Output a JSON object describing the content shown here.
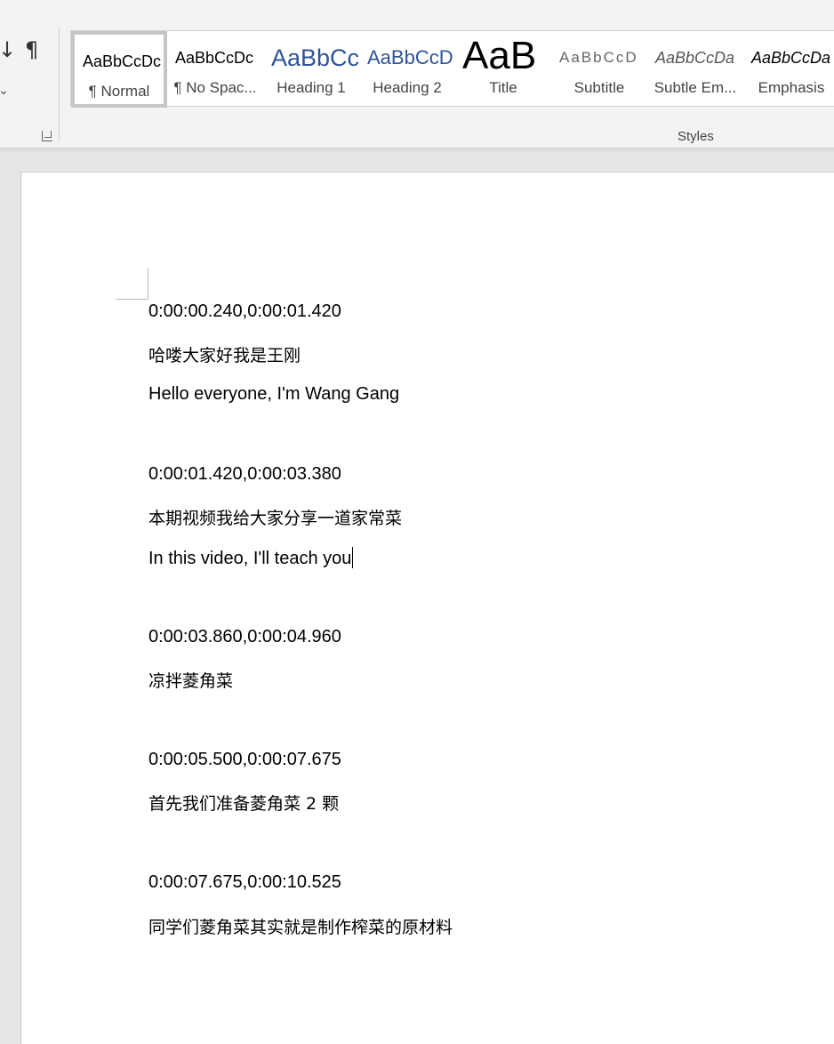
{
  "ribbon": {
    "sort_glyph": "↓",
    "show_marks_glyph": "¶",
    "dropdown_glyph": "⌄",
    "group_label": "Styles",
    "styles": [
      {
        "preview": "AaBbCcDc",
        "name": "¶ Normal"
      },
      {
        "preview": "AaBbCcDc",
        "name": "¶ No Spac..."
      },
      {
        "preview": "AaBbCc",
        "name": "Heading 1"
      },
      {
        "preview": "AaBbCcD",
        "name": "Heading 2"
      },
      {
        "preview": "AaB",
        "name": "Title"
      },
      {
        "preview": "AaBbCcD",
        "name": "Subtitle"
      },
      {
        "preview": "AaBbCcDa",
        "name": "Subtle Em..."
      },
      {
        "preview": "AaBbCcDa",
        "name": "Emphasis"
      }
    ]
  },
  "document": {
    "lines": [
      "0:00:00.240,0:00:01.420",
      "哈喽大家好我是王刚",
      "Hello everyone, I'm Wang Gang",
      "0:00:01.420,0:00:03.380",
      "本期视频我给大家分享一道家常菜",
      "In this video, I'll teach you",
      "0:00:03.860,0:00:04.960",
      "凉拌菱角菜",
      "0:00:05.500,0:00:07.675",
      "首先我们准备菱角菜 2 颗",
      "0:00:07.675,0:00:10.525",
      "同学们菱角菜其实就是制作榨菜的原材料"
    ]
  },
  "colors": {
    "ribbon_bg": "#f3f3f3",
    "heading_blue": "#2f5496",
    "page_bg": "#ffffff",
    "workspace_bg": "#e6e6e6"
  }
}
